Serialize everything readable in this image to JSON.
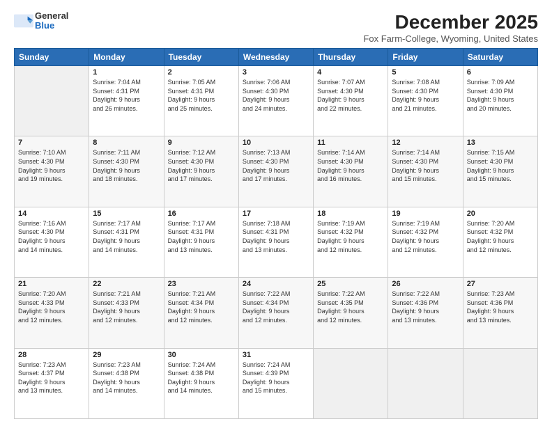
{
  "logo": {
    "general": "General",
    "blue": "Blue"
  },
  "title": "December 2025",
  "subtitle": "Fox Farm-College, Wyoming, United States",
  "days_of_week": [
    "Sunday",
    "Monday",
    "Tuesday",
    "Wednesday",
    "Thursday",
    "Friday",
    "Saturday"
  ],
  "weeks": [
    [
      {
        "day": "",
        "info": ""
      },
      {
        "day": "1",
        "info": "Sunrise: 7:04 AM\nSunset: 4:31 PM\nDaylight: 9 hours\nand 26 minutes."
      },
      {
        "day": "2",
        "info": "Sunrise: 7:05 AM\nSunset: 4:31 PM\nDaylight: 9 hours\nand 25 minutes."
      },
      {
        "day": "3",
        "info": "Sunrise: 7:06 AM\nSunset: 4:30 PM\nDaylight: 9 hours\nand 24 minutes."
      },
      {
        "day": "4",
        "info": "Sunrise: 7:07 AM\nSunset: 4:30 PM\nDaylight: 9 hours\nand 22 minutes."
      },
      {
        "day": "5",
        "info": "Sunrise: 7:08 AM\nSunset: 4:30 PM\nDaylight: 9 hours\nand 21 minutes."
      },
      {
        "day": "6",
        "info": "Sunrise: 7:09 AM\nSunset: 4:30 PM\nDaylight: 9 hours\nand 20 minutes."
      }
    ],
    [
      {
        "day": "7",
        "info": "Sunrise: 7:10 AM\nSunset: 4:30 PM\nDaylight: 9 hours\nand 19 minutes."
      },
      {
        "day": "8",
        "info": "Sunrise: 7:11 AM\nSunset: 4:30 PM\nDaylight: 9 hours\nand 18 minutes."
      },
      {
        "day": "9",
        "info": "Sunrise: 7:12 AM\nSunset: 4:30 PM\nDaylight: 9 hours\nand 17 minutes."
      },
      {
        "day": "10",
        "info": "Sunrise: 7:13 AM\nSunset: 4:30 PM\nDaylight: 9 hours\nand 17 minutes."
      },
      {
        "day": "11",
        "info": "Sunrise: 7:14 AM\nSunset: 4:30 PM\nDaylight: 9 hours\nand 16 minutes."
      },
      {
        "day": "12",
        "info": "Sunrise: 7:14 AM\nSunset: 4:30 PM\nDaylight: 9 hours\nand 15 minutes."
      },
      {
        "day": "13",
        "info": "Sunrise: 7:15 AM\nSunset: 4:30 PM\nDaylight: 9 hours\nand 15 minutes."
      }
    ],
    [
      {
        "day": "14",
        "info": "Sunrise: 7:16 AM\nSunset: 4:30 PM\nDaylight: 9 hours\nand 14 minutes."
      },
      {
        "day": "15",
        "info": "Sunrise: 7:17 AM\nSunset: 4:31 PM\nDaylight: 9 hours\nand 14 minutes."
      },
      {
        "day": "16",
        "info": "Sunrise: 7:17 AM\nSunset: 4:31 PM\nDaylight: 9 hours\nand 13 minutes."
      },
      {
        "day": "17",
        "info": "Sunrise: 7:18 AM\nSunset: 4:31 PM\nDaylight: 9 hours\nand 13 minutes."
      },
      {
        "day": "18",
        "info": "Sunrise: 7:19 AM\nSunset: 4:32 PM\nDaylight: 9 hours\nand 12 minutes."
      },
      {
        "day": "19",
        "info": "Sunrise: 7:19 AM\nSunset: 4:32 PM\nDaylight: 9 hours\nand 12 minutes."
      },
      {
        "day": "20",
        "info": "Sunrise: 7:20 AM\nSunset: 4:32 PM\nDaylight: 9 hours\nand 12 minutes."
      }
    ],
    [
      {
        "day": "21",
        "info": "Sunrise: 7:20 AM\nSunset: 4:33 PM\nDaylight: 9 hours\nand 12 minutes."
      },
      {
        "day": "22",
        "info": "Sunrise: 7:21 AM\nSunset: 4:33 PM\nDaylight: 9 hours\nand 12 minutes."
      },
      {
        "day": "23",
        "info": "Sunrise: 7:21 AM\nSunset: 4:34 PM\nDaylight: 9 hours\nand 12 minutes."
      },
      {
        "day": "24",
        "info": "Sunrise: 7:22 AM\nSunset: 4:34 PM\nDaylight: 9 hours\nand 12 minutes."
      },
      {
        "day": "25",
        "info": "Sunrise: 7:22 AM\nSunset: 4:35 PM\nDaylight: 9 hours\nand 12 minutes."
      },
      {
        "day": "26",
        "info": "Sunrise: 7:22 AM\nSunset: 4:36 PM\nDaylight: 9 hours\nand 13 minutes."
      },
      {
        "day": "27",
        "info": "Sunrise: 7:23 AM\nSunset: 4:36 PM\nDaylight: 9 hours\nand 13 minutes."
      }
    ],
    [
      {
        "day": "28",
        "info": "Sunrise: 7:23 AM\nSunset: 4:37 PM\nDaylight: 9 hours\nand 13 minutes."
      },
      {
        "day": "29",
        "info": "Sunrise: 7:23 AM\nSunset: 4:38 PM\nDaylight: 9 hours\nand 14 minutes."
      },
      {
        "day": "30",
        "info": "Sunrise: 7:24 AM\nSunset: 4:38 PM\nDaylight: 9 hours\nand 14 minutes."
      },
      {
        "day": "31",
        "info": "Sunrise: 7:24 AM\nSunset: 4:39 PM\nDaylight: 9 hours\nand 15 minutes."
      },
      {
        "day": "",
        "info": ""
      },
      {
        "day": "",
        "info": ""
      },
      {
        "day": "",
        "info": ""
      }
    ]
  ]
}
